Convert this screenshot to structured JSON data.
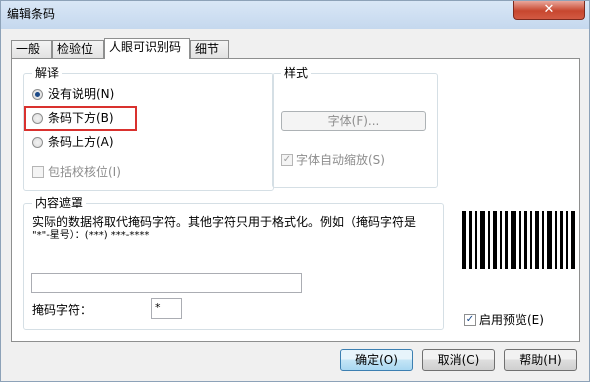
{
  "window": {
    "title": "编辑条码",
    "close_glyph": "✕"
  },
  "tabs": [
    {
      "label": "一般"
    },
    {
      "label": "检验位"
    },
    {
      "label": "人眼可识别码",
      "active": true
    },
    {
      "label": "细节"
    }
  ],
  "interpretation": {
    "title": "解译",
    "options": [
      {
        "label": "没有说明(N)",
        "selected": true
      },
      {
        "label": "条码下方(B)",
        "selected": false
      },
      {
        "label": "条码上方(A)",
        "selected": false
      }
    ],
    "include_check_digit": {
      "label": "包括校核位(I)",
      "checked": false,
      "enabled": false
    }
  },
  "style": {
    "title": "样式",
    "font_button": "字体(F)...",
    "auto_shrink": {
      "label": "字体自动缩放(S)",
      "checked": true,
      "enabled": false
    }
  },
  "content_mask": {
    "title": "内容遮罩",
    "description_line1": "实际的数据将取代掩码字符。其他字符只用于格式化。例如（掩码字符是",
    "description_line2": "\"*\"-星号）：(***) ***-****",
    "mask_value": "",
    "mask_char_label": "掩码字符：",
    "mask_char_value": "*"
  },
  "preview": {
    "enable_label": "启用预览(E)",
    "checked": true
  },
  "buttons": {
    "ok": "确定(O)",
    "cancel": "取消(C)",
    "help": "帮助(H)"
  },
  "colors": {
    "highlight": "#d9312e",
    "accent": "#3c7fb1"
  },
  "icons": {
    "checkmark": "✓"
  }
}
